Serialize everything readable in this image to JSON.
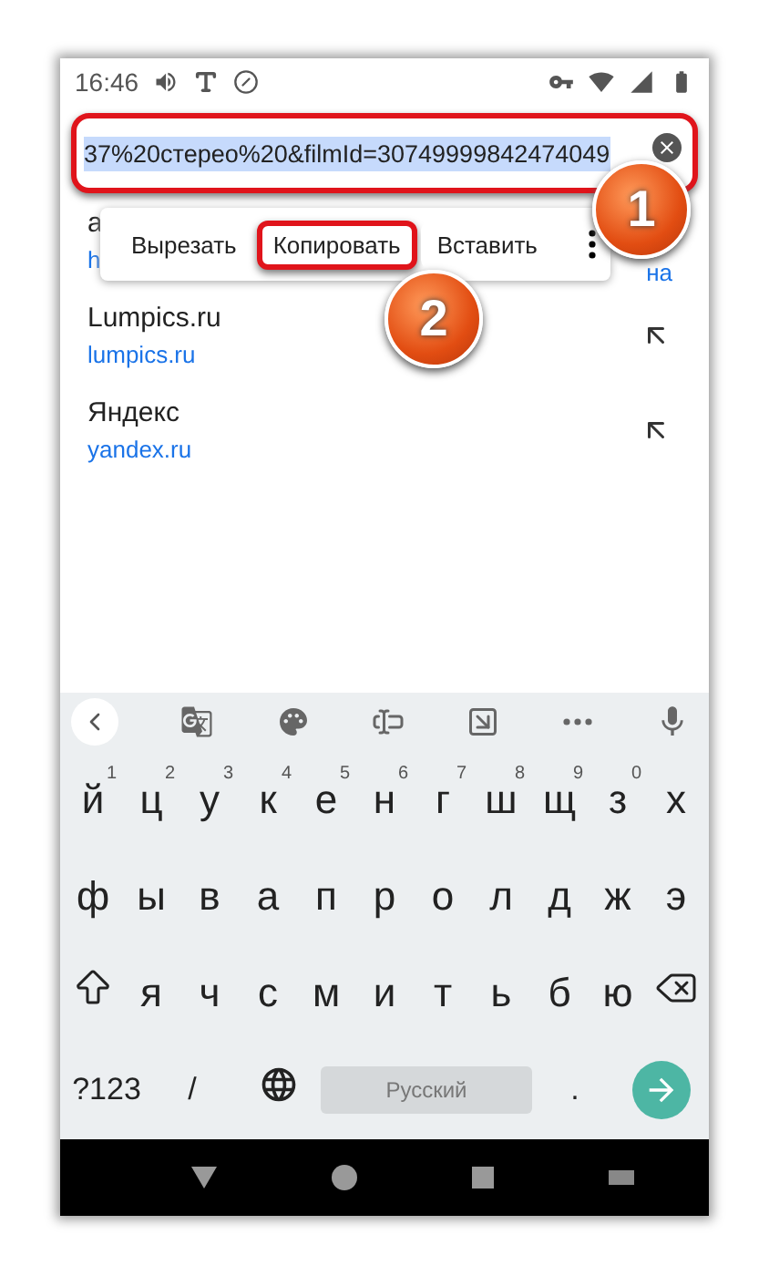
{
  "status_bar": {
    "time": "16:46"
  },
  "address_bar": {
    "value": "37%20стерео%20&filmId=30749999842474049",
    "selected": true,
    "highlighted": true
  },
  "context_menu": {
    "items": [
      {
        "label": "Вырезать",
        "highlighted": false
      },
      {
        "label": "Копировать",
        "highlighted": true
      },
      {
        "label": "Вставить",
        "highlighted": false
      }
    ]
  },
  "hidden_suggestion": {
    "title": "a",
    "url_start": "h",
    "url_end": "на"
  },
  "suggestions": [
    {
      "title": "Lumpics.ru",
      "url": "lumpics.ru"
    },
    {
      "title": "Яндекс",
      "url": "yandex.ru"
    }
  ],
  "keyboard": {
    "rows": [
      [
        {
          "key": "й",
          "hint": "1"
        },
        {
          "key": "ц",
          "hint": "2"
        },
        {
          "key": "у",
          "hint": "3"
        },
        {
          "key": "к",
          "hint": "4"
        },
        {
          "key": "е",
          "hint": "5"
        },
        {
          "key": "н",
          "hint": "6"
        },
        {
          "key": "г",
          "hint": "7"
        },
        {
          "key": "ш",
          "hint": "8"
        },
        {
          "key": "щ",
          "hint": "9"
        },
        {
          "key": "з",
          "hint": "0"
        },
        {
          "key": "х"
        }
      ],
      [
        {
          "key": "ф"
        },
        {
          "key": "ы"
        },
        {
          "key": "в"
        },
        {
          "key": "а"
        },
        {
          "key": "п"
        },
        {
          "key": "р"
        },
        {
          "key": "о"
        },
        {
          "key": "л"
        },
        {
          "key": "д"
        },
        {
          "key": "ж"
        },
        {
          "key": "э"
        }
      ],
      [
        {
          "kind": "shift"
        },
        {
          "key": "я"
        },
        {
          "key": "ч"
        },
        {
          "key": "с"
        },
        {
          "key": "м"
        },
        {
          "key": "и"
        },
        {
          "key": "т"
        },
        {
          "key": "ь"
        },
        {
          "key": "б"
        },
        {
          "key": "ю"
        },
        {
          "kind": "backspace"
        }
      ]
    ],
    "symbols_key": "?123",
    "slash_key": "/",
    "space_label": "Русский",
    "period_key": "."
  },
  "annotations": [
    {
      "label": "1"
    },
    {
      "label": "2"
    }
  ]
}
